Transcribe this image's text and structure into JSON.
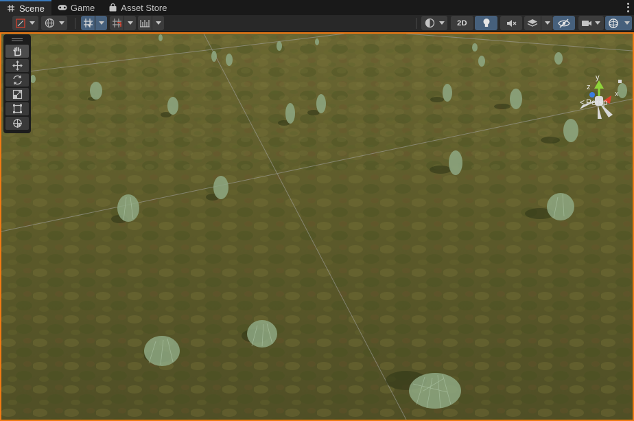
{
  "window": {
    "tabs": [
      {
        "label": "Scene",
        "icon": "hash-grid-icon",
        "active": true
      },
      {
        "label": "Game",
        "icon": "gamepad-icon",
        "active": false
      },
      {
        "label": "Asset Store",
        "icon": "shopping-bag-icon",
        "active": false
      }
    ]
  },
  "toolbar": {
    "mode_2d_label": "2D"
  },
  "tools": [
    "hand-tool",
    "move-tool",
    "rotate-tool",
    "scale-tool",
    "rect-tool",
    "transform-tool"
  ],
  "gizmo": {
    "axis_y": "y",
    "axis_x": "x",
    "axis_z": "z",
    "projection": "Persp",
    "colors": {
      "x": "#e0412d",
      "y": "#8fd43a",
      "z": "#3c7ee0"
    }
  },
  "colors": {
    "accent": "#3a79bb",
    "viewport_border": "#f07a14",
    "toggle_on": "#46607c"
  }
}
